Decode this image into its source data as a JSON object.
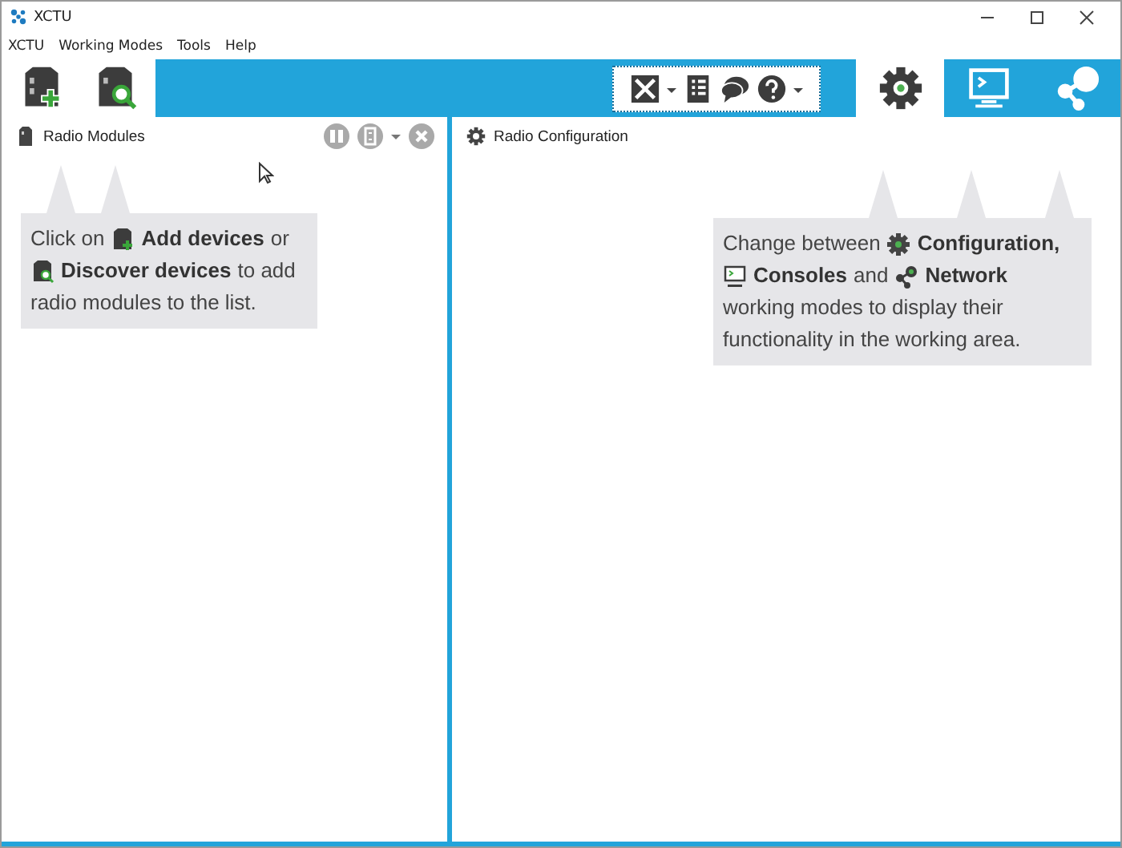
{
  "window": {
    "title": "XCTU"
  },
  "menu": [
    "XCTU",
    "Working Modes",
    "Tools",
    "Help"
  ],
  "modes": [
    {
      "kind": "configuration",
      "selected": true
    },
    {
      "kind": "consoles",
      "selected": false
    },
    {
      "kind": "network",
      "selected": false
    }
  ],
  "left_panel": {
    "title": "Radio Modules"
  },
  "right_panel": {
    "title": "Radio Configuration"
  },
  "tips": [
    {
      "lines": [
        [
          {
            "kind": "text",
            "text": "Click on"
          },
          {
            "kind": "add-device"
          },
          {
            "kind": "bold",
            "text": "Add devices"
          },
          {
            "kind": "text",
            "text": "or"
          }
        ],
        [
          {
            "kind": "discover-device"
          },
          {
            "kind": "bold",
            "text": "Discover devices"
          },
          {
            "kind": "text",
            "text": "to add"
          }
        ],
        [
          {
            "kind": "text",
            "text": "radio modules to the list."
          }
        ]
      ]
    },
    {
      "lines": [
        [
          {
            "kind": "text",
            "text": "Change between"
          },
          {
            "kind": "gear"
          },
          {
            "kind": "bold",
            "text": "Configuration,"
          }
        ],
        [
          {
            "kind": "monitor"
          },
          {
            "kind": "bold",
            "text": "Consoles"
          },
          {
            "kind": "text",
            "text": "and"
          },
          {
            "kind": "network"
          },
          {
            "kind": "bold",
            "text": "Network"
          }
        ],
        [
          {
            "kind": "text",
            "text": "working modes to display their"
          }
        ],
        [
          {
            "kind": "text",
            "text": "functionality in the working area."
          }
        ]
      ]
    }
  ]
}
